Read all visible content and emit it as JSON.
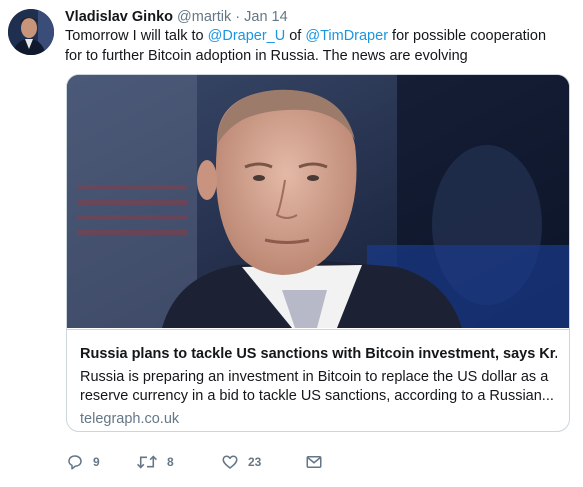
{
  "tweet": {
    "author_name": "Vladislav Ginko",
    "handle": "@martik",
    "separator": "·",
    "date": "Jan 14",
    "text_part1": "Tomorrow I will talk to ",
    "mention1": "@Draper_U",
    "text_part2": " of ",
    "mention2": "@TimDraper",
    "text_part3": " for possible cooperation for to further Bitcoin adoption in Russia. The news are evolving"
  },
  "card": {
    "title": "Russia plans to tackle US sanctions with Bitcoin investment, says Kr...",
    "description": "Russia is preparing an investment in Bitcoin to replace the US dollar as a reserve currency in a bid to tackle US sanctions, according to a Russian...",
    "domain": "telegraph.co.uk"
  },
  "actions": {
    "replies": "9",
    "retweets": "8",
    "likes": "23"
  },
  "icons": {
    "reply": "reply-icon",
    "retweet": "retweet-icon",
    "like": "heart-icon",
    "message": "envelope-icon"
  },
  "colors": {
    "link": "#1b95e0",
    "secondary": "#657786",
    "border": "#ccd6dd"
  }
}
